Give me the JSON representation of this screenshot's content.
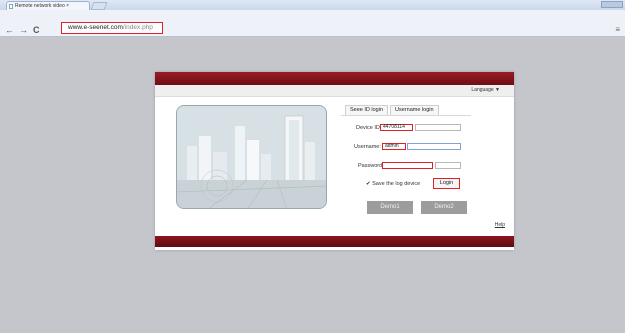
{
  "browser": {
    "tab_title": "Remote network video  ×",
    "url_domain": "www.e-seenet.com",
    "url_path": "/index.php",
    "back_label": "←",
    "forward_label": "→",
    "reload_label": "C"
  },
  "header": {
    "language_label": "Language ▼"
  },
  "login": {
    "tabs": [
      "Seee ID login",
      "Username login"
    ],
    "device_id_label": "Device ID:",
    "device_id_value": "44708114",
    "username_label": "Username:",
    "username_value": "admin",
    "password_label": "Password:",
    "password_value": "",
    "save_label": "Save the log device",
    "login_button": "Login",
    "demo1": "Demo1",
    "demo2": "Demo2",
    "help": "Help"
  },
  "colors": {
    "brand_red": "#8c1520",
    "highlight_red": "#e0202a",
    "page_bg": "#c4c6cb"
  }
}
